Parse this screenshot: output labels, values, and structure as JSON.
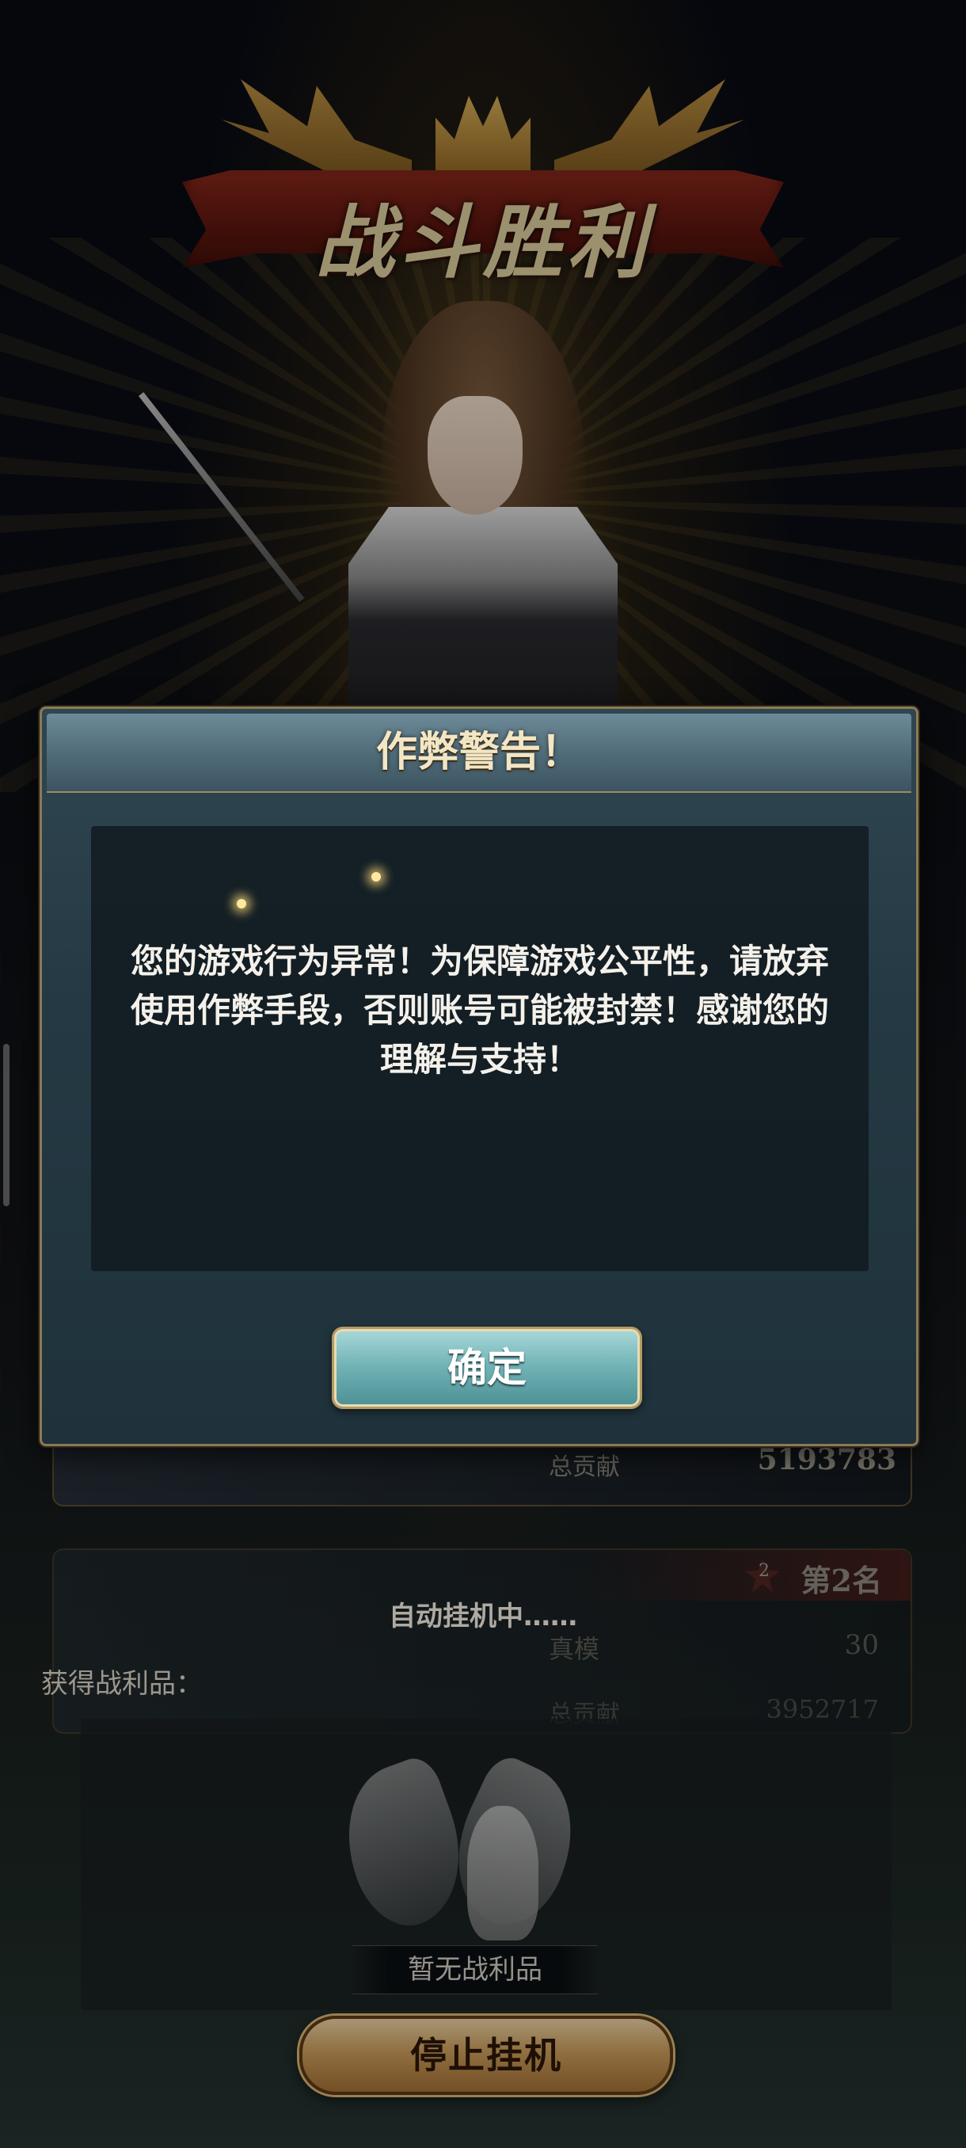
{
  "banner": {
    "title": "战斗胜利"
  },
  "leaderboard": {
    "first": {
      "contribution_label": "总贡献",
      "contribution_value": "5193783"
    },
    "second": {
      "rank_badge": "2",
      "rank_label": "第2名",
      "row_a_label": "真模",
      "row_a_value": "30",
      "row_b_label": "总贡献",
      "row_b_value": "3952717"
    }
  },
  "auto_status": "自动挂机中……",
  "loot": {
    "label": "获得战利品：",
    "empty_text": "暂无战利品"
  },
  "stop_button": "停止挂机",
  "dialog": {
    "title": "作弊警告！",
    "message": "您的游戏行为异常！为保障游戏公平性，请放弃使用作弊手段，否则账号可能被封禁！感谢您的理解与支持！",
    "confirm_label": "确定"
  },
  "colors": {
    "accent_gold": "#c89a5a",
    "dialog_bg": "#253944",
    "confirm_teal": "#6fb1b4",
    "banner_red": "#8b2a1c"
  }
}
